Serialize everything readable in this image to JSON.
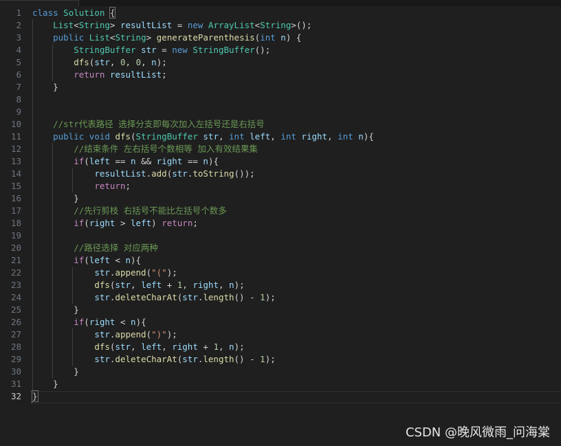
{
  "watermark": "CSDN @晚风微雨_问海棠",
  "active_line": 32,
  "lines": [
    {
      "no": "1",
      "tokens": [
        [
          "k",
          "class"
        ],
        [
          "p",
          " "
        ],
        [
          "c",
          "Solution"
        ],
        [
          "p",
          " "
        ],
        [
          "brk",
          "{"
        ]
      ]
    },
    {
      "no": "2",
      "tokens": [
        [
          "p",
          "    "
        ],
        [
          "c",
          "List"
        ],
        [
          "p",
          "<"
        ],
        [
          "c",
          "String"
        ],
        [
          "p",
          "> "
        ],
        [
          "v",
          "resultList"
        ],
        [
          "p",
          " = "
        ],
        [
          "k",
          "new"
        ],
        [
          "p",
          " "
        ],
        [
          "c",
          "ArrayList"
        ],
        [
          "p",
          "<"
        ],
        [
          "c",
          "String"
        ],
        [
          "p",
          ">();"
        ]
      ]
    },
    {
      "no": "3",
      "tokens": [
        [
          "p",
          "    "
        ],
        [
          "k",
          "public"
        ],
        [
          "p",
          " "
        ],
        [
          "c",
          "List"
        ],
        [
          "p",
          "<"
        ],
        [
          "c",
          "String"
        ],
        [
          "p",
          "> "
        ],
        [
          "f",
          "generateParenthesis"
        ],
        [
          "p",
          "("
        ],
        [
          "k",
          "int"
        ],
        [
          "p",
          " "
        ],
        [
          "v",
          "n"
        ],
        [
          "p",
          ") {"
        ]
      ]
    },
    {
      "no": "4",
      "tokens": [
        [
          "p",
          "        "
        ],
        [
          "c",
          "StringBuffer"
        ],
        [
          "p",
          " "
        ],
        [
          "v",
          "str"
        ],
        [
          "p",
          " = "
        ],
        [
          "k",
          "new"
        ],
        [
          "p",
          " "
        ],
        [
          "c",
          "StringBuffer"
        ],
        [
          "p",
          "();"
        ]
      ]
    },
    {
      "no": "5",
      "tokens": [
        [
          "p",
          "        "
        ],
        [
          "f",
          "dfs"
        ],
        [
          "p",
          "("
        ],
        [
          "v",
          "str"
        ],
        [
          "p",
          ", "
        ],
        [
          "n",
          "0"
        ],
        [
          "p",
          ", "
        ],
        [
          "n",
          "0"
        ],
        [
          "p",
          ", "
        ],
        [
          "v",
          "n"
        ],
        [
          "p",
          ");"
        ]
      ]
    },
    {
      "no": "6",
      "tokens": [
        [
          "p",
          "        "
        ],
        [
          "ctl",
          "return"
        ],
        [
          "p",
          " "
        ],
        [
          "v",
          "resultList"
        ],
        [
          "p",
          ";"
        ]
      ]
    },
    {
      "no": "7",
      "tokens": [
        [
          "p",
          "    }"
        ]
      ]
    },
    {
      "no": "8",
      "tokens": []
    },
    {
      "no": "9",
      "tokens": []
    },
    {
      "no": "10",
      "tokens": [
        [
          "p",
          "    "
        ],
        [
          "cm",
          "//str代表路径 选择分支即每次加入左括号还是右括号"
        ]
      ]
    },
    {
      "no": "11",
      "tokens": [
        [
          "p",
          "    "
        ],
        [
          "k",
          "public"
        ],
        [
          "p",
          " "
        ],
        [
          "k",
          "void"
        ],
        [
          "p",
          " "
        ],
        [
          "f",
          "dfs"
        ],
        [
          "p",
          "("
        ],
        [
          "c",
          "StringBuffer"
        ],
        [
          "p",
          " "
        ],
        [
          "v",
          "str"
        ],
        [
          "p",
          ", "
        ],
        [
          "k",
          "int"
        ],
        [
          "p",
          " "
        ],
        [
          "v",
          "left"
        ],
        [
          "p",
          ", "
        ],
        [
          "k",
          "int"
        ],
        [
          "p",
          " "
        ],
        [
          "v",
          "right"
        ],
        [
          "p",
          ", "
        ],
        [
          "k",
          "int"
        ],
        [
          "p",
          " "
        ],
        [
          "v",
          "n"
        ],
        [
          "p",
          "){"
        ]
      ]
    },
    {
      "no": "12",
      "tokens": [
        [
          "p",
          "        "
        ],
        [
          "cm",
          "//结束条件 左右括号个数相等 加入有效结果集"
        ]
      ]
    },
    {
      "no": "13",
      "tokens": [
        [
          "p",
          "        "
        ],
        [
          "ctl",
          "if"
        ],
        [
          "p",
          "("
        ],
        [
          "v",
          "left"
        ],
        [
          "p",
          " == "
        ],
        [
          "v",
          "n"
        ],
        [
          "p",
          " && "
        ],
        [
          "v",
          "right"
        ],
        [
          "p",
          " == "
        ],
        [
          "v",
          "n"
        ],
        [
          "p",
          "){"
        ]
      ]
    },
    {
      "no": "14",
      "tokens": [
        [
          "p",
          "            "
        ],
        [
          "v",
          "resultList"
        ],
        [
          "p",
          "."
        ],
        [
          "f",
          "add"
        ],
        [
          "p",
          "("
        ],
        [
          "v",
          "str"
        ],
        [
          "p",
          "."
        ],
        [
          "f",
          "toString"
        ],
        [
          "p",
          "());"
        ]
      ]
    },
    {
      "no": "15",
      "tokens": [
        [
          "p",
          "            "
        ],
        [
          "ctl",
          "return"
        ],
        [
          "p",
          ";"
        ]
      ]
    },
    {
      "no": "16",
      "tokens": [
        [
          "p",
          "        }"
        ]
      ]
    },
    {
      "no": "17",
      "tokens": [
        [
          "p",
          "        "
        ],
        [
          "cm",
          "//先行剪枝 右括号不能比左括号个数多"
        ]
      ]
    },
    {
      "no": "18",
      "tokens": [
        [
          "p",
          "        "
        ],
        [
          "ctl",
          "if"
        ],
        [
          "p",
          "("
        ],
        [
          "v",
          "right"
        ],
        [
          "p",
          " > "
        ],
        [
          "v",
          "left"
        ],
        [
          "p",
          ") "
        ],
        [
          "ctl",
          "return"
        ],
        [
          "p",
          ";"
        ]
      ]
    },
    {
      "no": "19",
      "tokens": []
    },
    {
      "no": "20",
      "tokens": [
        [
          "p",
          "        "
        ],
        [
          "cm",
          "//路径选择 对应两种"
        ]
      ]
    },
    {
      "no": "21",
      "tokens": [
        [
          "p",
          "        "
        ],
        [
          "ctl",
          "if"
        ],
        [
          "p",
          "("
        ],
        [
          "v",
          "left"
        ],
        [
          "p",
          " < "
        ],
        [
          "v",
          "n"
        ],
        [
          "p",
          "){"
        ]
      ]
    },
    {
      "no": "22",
      "tokens": [
        [
          "p",
          "            "
        ],
        [
          "v",
          "str"
        ],
        [
          "p",
          "."
        ],
        [
          "f",
          "append"
        ],
        [
          "p",
          "("
        ],
        [
          "s",
          "\"(\""
        ],
        [
          "p",
          ");"
        ]
      ]
    },
    {
      "no": "23",
      "tokens": [
        [
          "p",
          "            "
        ],
        [
          "f",
          "dfs"
        ],
        [
          "p",
          "("
        ],
        [
          "v",
          "str"
        ],
        [
          "p",
          ", "
        ],
        [
          "v",
          "left"
        ],
        [
          "p",
          " + "
        ],
        [
          "n",
          "1"
        ],
        [
          "p",
          ", "
        ],
        [
          "v",
          "right"
        ],
        [
          "p",
          ", "
        ],
        [
          "v",
          "n"
        ],
        [
          "p",
          ");"
        ]
      ]
    },
    {
      "no": "24",
      "tokens": [
        [
          "p",
          "            "
        ],
        [
          "v",
          "str"
        ],
        [
          "p",
          "."
        ],
        [
          "f",
          "deleteCharAt"
        ],
        [
          "p",
          "("
        ],
        [
          "v",
          "str"
        ],
        [
          "p",
          "."
        ],
        [
          "f",
          "length"
        ],
        [
          "p",
          "() - "
        ],
        [
          "n",
          "1"
        ],
        [
          "p",
          ");"
        ]
      ]
    },
    {
      "no": "25",
      "tokens": [
        [
          "p",
          "        }"
        ]
      ]
    },
    {
      "no": "26",
      "tokens": [
        [
          "p",
          "        "
        ],
        [
          "ctl",
          "if"
        ],
        [
          "p",
          "("
        ],
        [
          "v",
          "right"
        ],
        [
          "p",
          " < "
        ],
        [
          "v",
          "n"
        ],
        [
          "p",
          "){"
        ]
      ]
    },
    {
      "no": "27",
      "tokens": [
        [
          "p",
          "            "
        ],
        [
          "v",
          "str"
        ],
        [
          "p",
          "."
        ],
        [
          "f",
          "append"
        ],
        [
          "p",
          "("
        ],
        [
          "s",
          "\")\""
        ],
        [
          "p",
          ");"
        ]
      ]
    },
    {
      "no": "28",
      "tokens": [
        [
          "p",
          "            "
        ],
        [
          "f",
          "dfs"
        ],
        [
          "p",
          "("
        ],
        [
          "v",
          "str"
        ],
        [
          "p",
          ", "
        ],
        [
          "v",
          "left"
        ],
        [
          "p",
          ", "
        ],
        [
          "v",
          "right"
        ],
        [
          "p",
          " + "
        ],
        [
          "n",
          "1"
        ],
        [
          "p",
          ", "
        ],
        [
          "v",
          "n"
        ],
        [
          "p",
          ");"
        ]
      ]
    },
    {
      "no": "29",
      "tokens": [
        [
          "p",
          "            "
        ],
        [
          "v",
          "str"
        ],
        [
          "p",
          "."
        ],
        [
          "f",
          "deleteCharAt"
        ],
        [
          "p",
          "("
        ],
        [
          "v",
          "str"
        ],
        [
          "p",
          "."
        ],
        [
          "f",
          "length"
        ],
        [
          "p",
          "() - "
        ],
        [
          "n",
          "1"
        ],
        [
          "p",
          ");"
        ]
      ]
    },
    {
      "no": "30",
      "tokens": [
        [
          "p",
          "        }"
        ]
      ]
    },
    {
      "no": "31",
      "tokens": [
        [
          "p",
          "    }"
        ]
      ]
    },
    {
      "no": "32",
      "tokens": [
        [
          "brk",
          "}"
        ]
      ]
    }
  ]
}
